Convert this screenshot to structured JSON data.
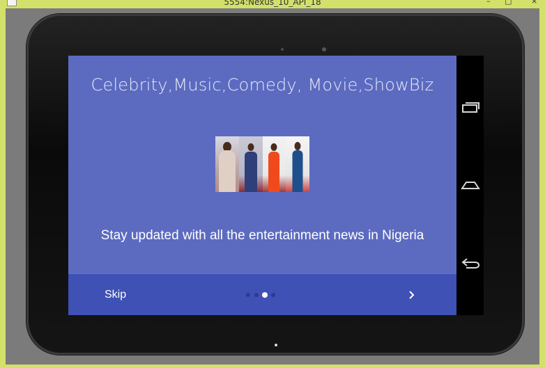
{
  "window": {
    "title": "5554:Nexus_10_API_18",
    "minimize_label": "–",
    "maximize_label": "□",
    "close_label": "×"
  },
  "screen": {
    "headline": "Celebrity,Music,Comedy,  Movie,ShowBiz",
    "description": "Stay updated with all the entertainment news in Nigeria",
    "skip_label": "Skip",
    "page_count": 4,
    "active_page": 3,
    "next_icon": "chevron-right-icon",
    "background_color": "#5c6bc0",
    "bottom_bar_color": "#3f51b5"
  },
  "nav_bar": {
    "buttons": [
      "recents-icon",
      "home-icon",
      "back-icon"
    ]
  }
}
